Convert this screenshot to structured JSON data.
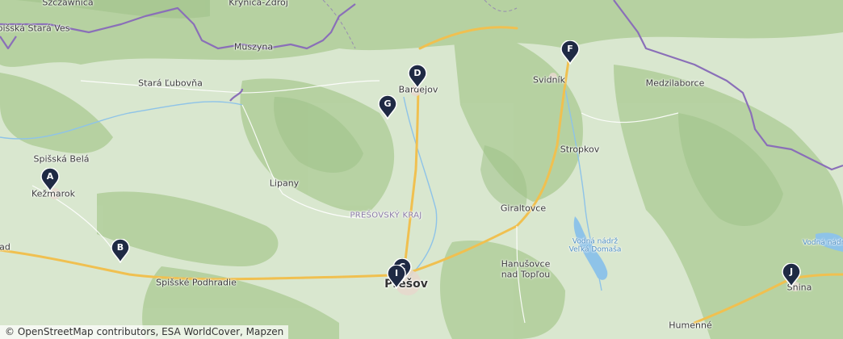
{
  "places": {
    "szczawnica": "Szczawnica",
    "spisska_stara_ves": "Spišská Stará Ves",
    "krynica": "Krynica-Zdrój",
    "muszyna": "Muszyna",
    "stara_lubovna": "Stará Ľubovňa",
    "spisska_bela": "Spišská Belá",
    "kezmarok": "Kežmarok",
    "lipany": "Lipany",
    "presovsky_kraj": "PREŠOVSKÝ KRAJ",
    "spisske_podhradie": "Spišské Podhradie",
    "bardejov": "Bardejov",
    "svidnik": "Svidník",
    "medzilaborce": "Medzilaborce",
    "stropkov": "Stropkov",
    "giraltovce": "Giraltovce",
    "hanusovce": "Hanušovce\nnad Topľou",
    "domasa": "Vodná nádrž\nVeľká Domaša",
    "vodna_nadrz": "Vodná nádrž",
    "presov": "Prešov",
    "snina": "Snina",
    "humenne": "Humenné",
    "ad": "ad"
  },
  "markers": [
    {
      "id": "A",
      "color": "#1f2a44"
    },
    {
      "id": "B",
      "color": "#1f2a44"
    },
    {
      "id": "D",
      "color": "#1f2a44"
    },
    {
      "id": "F",
      "color": "#1f2a44"
    },
    {
      "id": "G",
      "color": "#1f2a44"
    },
    {
      "id": "C",
      "color": "#1f2a44"
    },
    {
      "id": "I",
      "color": "#1f2a44"
    },
    {
      "id": "J",
      "color": "#1f2a44"
    }
  ],
  "attribution": "© OpenStreetMap contributors, ESA WorldCover, Mapzen",
  "colors": {
    "land": "#d7e6cc",
    "forest": "#a9c893",
    "road_major": "#f2c24f",
    "border": "#8a6fb8",
    "water": "#8ec3e8"
  }
}
